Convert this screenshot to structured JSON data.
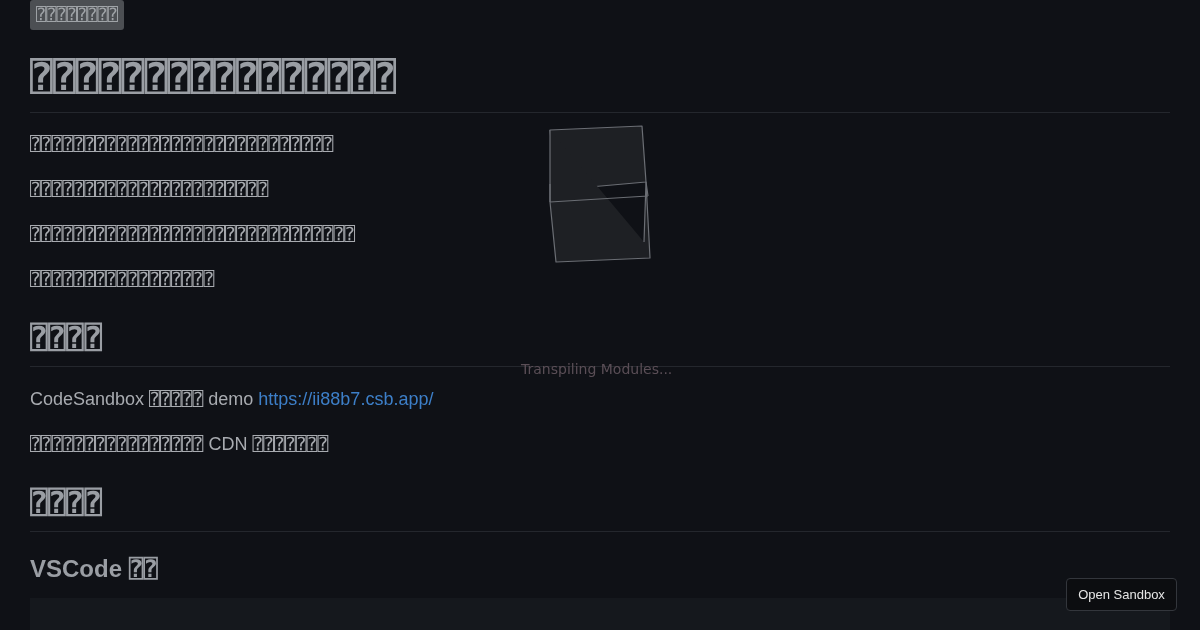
{
  "badge": "⍰⍰⍰⍰⍰⍰⍰⍰",
  "title": "⍰⍰⍰⍰⍰⍰⍰⍰⍰⍰⍰⍰⍰⍰⍰⍰",
  "intro": [
    "⍰⍰⍰⍰⍰⍰⍰⍰⍰⍰⍰⍰⍰⍰⍰⍰⍰⍰⍰⍰⍰⍰⍰⍰⍰⍰⍰⍰",
    "⍰⍰⍰⍰⍰⍰⍰⍰⍰⍰⍰⍰⍰⍰⍰⍰⍰⍰⍰⍰⍰⍰",
    "⍰⍰⍰⍰⍰⍰⍰⍰⍰⍰⍰⍰⍰⍰⍰⍰⍰⍰⍰⍰⍰⍰⍰⍰⍰⍰⍰⍰⍰⍰",
    "⍰⍰⍰⍰⍰⍰⍰⍰⍰⍰⍰⍰⍰⍰⍰⍰⍰"
  ],
  "sections": [
    {
      "heading": "⍰⍰⍰⍰",
      "paragraphs": [
        [
          {
            "text": "CodeSandbox ⍰⍰⍰⍰⍰ demo "
          },
          {
            "text": "https://ii88b7.csb.app/",
            "link": true
          }
        ],
        [
          {
            "text": "⍰⍰⍰⍰⍰⍰⍰⍰⍰⍰⍰⍰⍰⍰⍰⍰ CDN ⍰⍰⍰⍰⍰⍰⍰"
          }
        ]
      ]
    },
    {
      "heading": "⍰⍰⍰⍰",
      "subheading": "VSCode ⍰⍰"
    }
  ],
  "loader": {
    "status": "Transpiling Modules..."
  },
  "open_button": "Open Sandbox"
}
